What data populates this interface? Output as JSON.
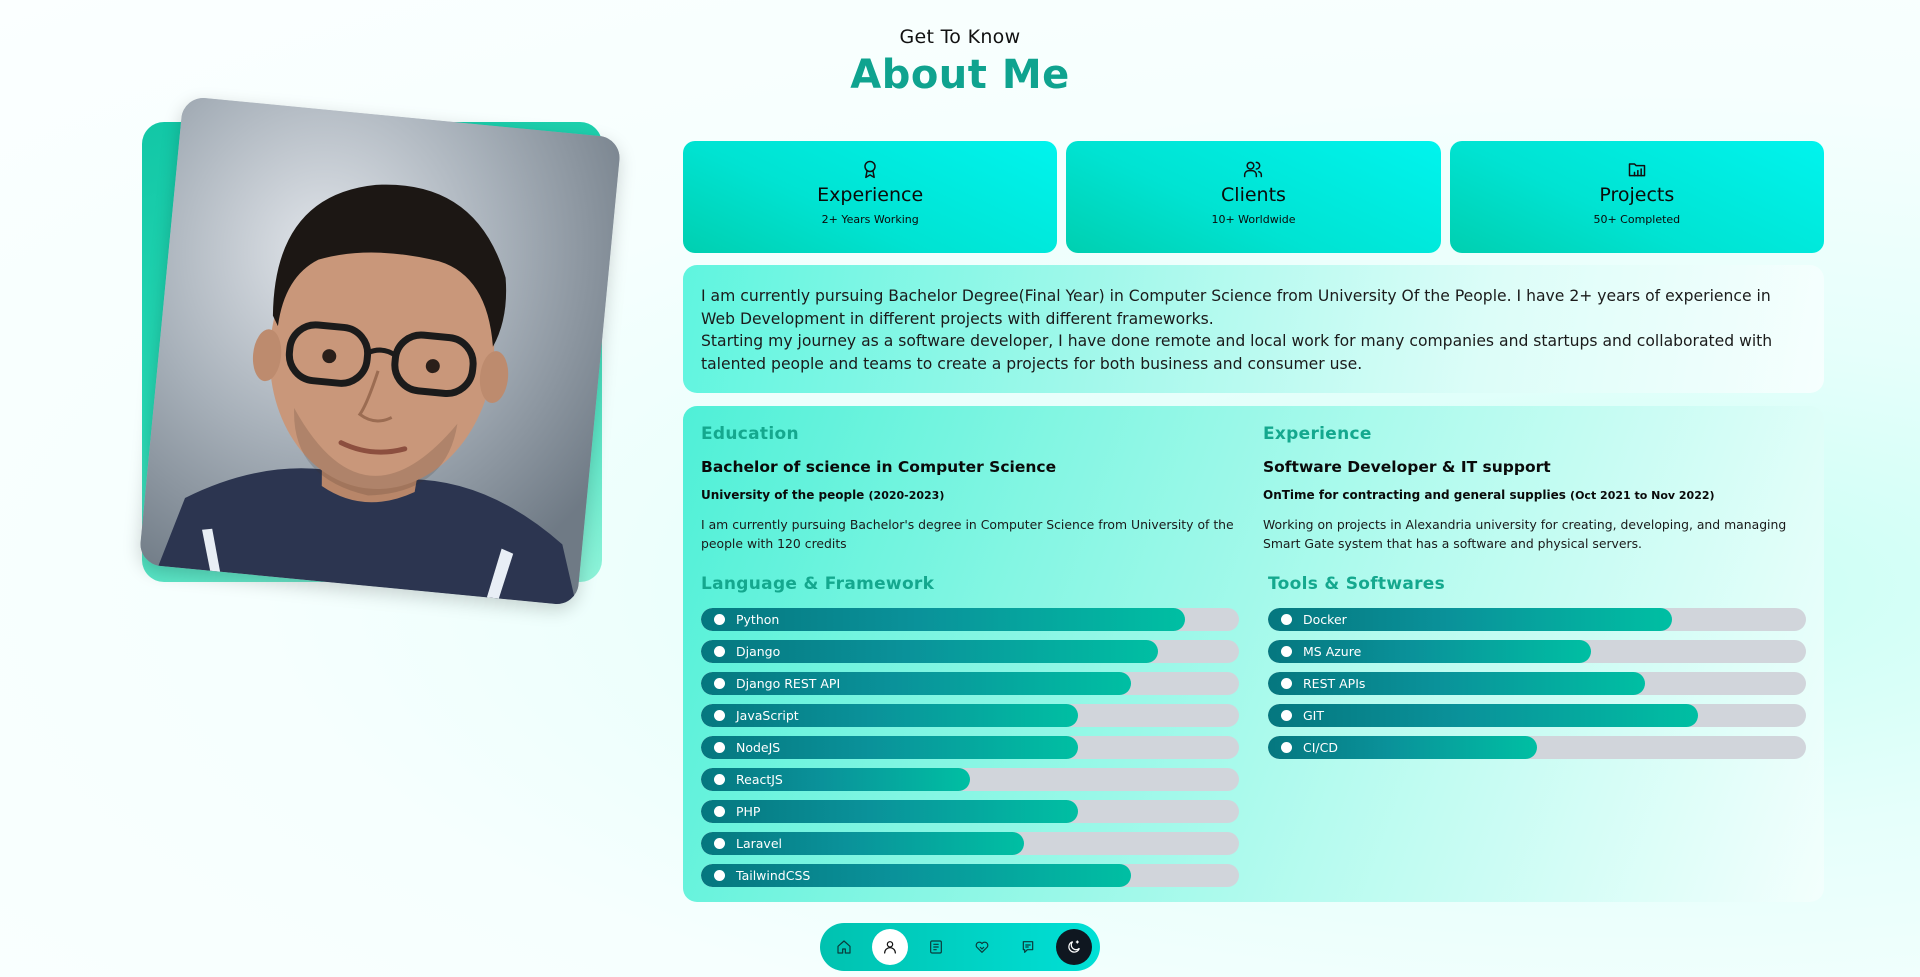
{
  "heading": {
    "subtitle": "Get To Know",
    "title": "About Me"
  },
  "photo": {
    "alt": "Profile photo"
  },
  "stats": [
    {
      "icon": "award-icon",
      "title": "Experience",
      "subtitle": "2+ Years Working"
    },
    {
      "icon": "users-icon",
      "title": "Clients",
      "subtitle": "10+ Worldwide"
    },
    {
      "icon": "folder-icon",
      "title": "Projects",
      "subtitle": "50+ Completed"
    }
  ],
  "bio": {
    "line1": "I am currently pursuing Bachelor Degree(Final Year) in Computer Science from University Of the People. I have 2+ years of experience in Web Development in different projects with different frameworks.",
    "line2": "Starting my journey as a software developer, I have done remote and local work for many companies and startups and collaborated with talented people and teams to create a projects for both business and consumer use."
  },
  "education": {
    "heading": "Education",
    "degree": "Bachelor of science in Computer Science",
    "institution": "University of the people",
    "dates": "(2020-2023)",
    "description": "I am currently pursuing Bachelor's degree in Computer Science from University of the people with 120 credits"
  },
  "experience": {
    "heading": "Experience",
    "role": "Software Developer & IT support",
    "company": "OnTime for contracting and general supplies",
    "dates": "(Oct 2021 to Nov 2022)",
    "description": "Working on projects in Alexandria university for creating, developing, and managing Smart Gate system that has a software and physical servers."
  },
  "languages": {
    "heading": "Language & Framework",
    "skills": [
      {
        "name": "Python",
        "percent": 90
      },
      {
        "name": "Django",
        "percent": 85
      },
      {
        "name": "Django REST API",
        "percent": 80
      },
      {
        "name": "JavaScript",
        "percent": 70
      },
      {
        "name": "NodeJS",
        "percent": 70
      },
      {
        "name": "ReactJS",
        "percent": 50
      },
      {
        "name": "PHP",
        "percent": 70
      },
      {
        "name": "Laravel",
        "percent": 60
      },
      {
        "name": "TailwindCSS",
        "percent": 80
      }
    ]
  },
  "tools": {
    "heading": "Tools & Softwares",
    "skills": [
      {
        "name": "Docker",
        "percent": 75
      },
      {
        "name": "MS Azure",
        "percent": 60
      },
      {
        "name": "REST APIs",
        "percent": 70
      },
      {
        "name": "GIT",
        "percent": 80
      },
      {
        "name": "CI/CD",
        "percent": 50
      }
    ]
  },
  "nav": {
    "items": [
      {
        "name": "home-icon",
        "active": false
      },
      {
        "name": "user-icon",
        "active": true
      },
      {
        "name": "portfolio-icon",
        "active": false
      },
      {
        "name": "handshake-icon",
        "active": false
      },
      {
        "name": "message-icon",
        "active": false
      },
      {
        "name": "moon-icon",
        "active": false
      }
    ]
  },
  "colors": {
    "accent": "#0fa38f",
    "card": "#00e3d2",
    "bar_fill": "#05777f",
    "bar_track": "#d1d5db"
  }
}
